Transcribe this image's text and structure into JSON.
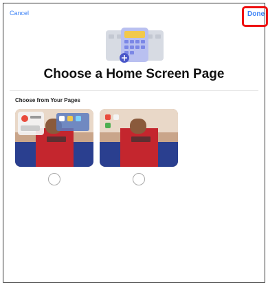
{
  "nav": {
    "cancel_label": "Cancel",
    "done_label": "Done"
  },
  "header": {
    "title": "Choose a Home Screen Page",
    "icon": "home-screen-pages-icon"
  },
  "section": {
    "label": "Choose from Your Pages"
  },
  "pages": [
    {
      "selected": false
    },
    {
      "selected": false
    }
  ],
  "colors": {
    "accent": "#3b82f6",
    "highlight": "#ee1111"
  }
}
